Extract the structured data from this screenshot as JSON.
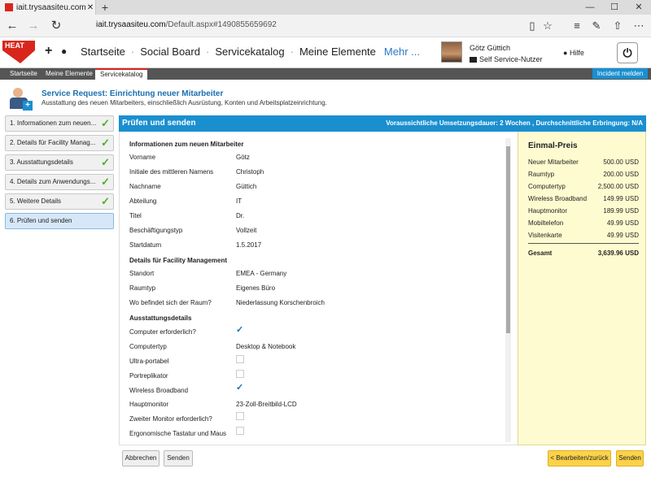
{
  "browser": {
    "tab_title": "iait.trysaasiteu.com:Serv",
    "tab_close": "✕",
    "new_tab": "+",
    "url_host": "iait.trysaasiteu.com",
    "url_path": "/Default.aspx#1490855659692",
    "win_minimize": "—",
    "win_maximize": "☐",
    "win_close": "✕"
  },
  "header": {
    "logo_text": "HEAT",
    "nav_items": [
      "Startseite",
      "Social Board",
      "Servicekatalog",
      "Meine Elemente"
    ],
    "more_label": "Mehr ...",
    "user_name": "Götz Güttich",
    "user_role": "Self Service-Nutzer",
    "help_label": "Hilfe"
  },
  "subnav": {
    "tabs": [
      "Startseite",
      "Meine Elemente",
      "Servicekatalog"
    ],
    "incident_button": "Incident melden"
  },
  "service_request": {
    "title": "Service Request: Einrichtung neuer Mitarbeiter",
    "description": "Ausstattung des neuen Mitarbeiters, einschließlich Ausrüstung, Konten und Arbeitsplatzeinrichtung."
  },
  "steps": [
    {
      "label": "1. Informationen zum neuen...",
      "done": true
    },
    {
      "label": "2. Details für Facility Manag...",
      "done": true
    },
    {
      "label": "3. Ausstattungsdetails",
      "done": true
    },
    {
      "label": "4. Details zum Anwendungs...",
      "done": true
    },
    {
      "label": "5. Weitere Details",
      "done": true
    },
    {
      "label": "6. Prüfen und senden",
      "done": false
    }
  ],
  "panel": {
    "title": "Prüfen und senden",
    "info": "Voraussichtliche Umsetzungsdauer: 2 Wochen , Durchschnittliche Erbringung: N/A"
  },
  "form": {
    "section1_title": "Informationen zum neuen Mitarbeiter",
    "section1": [
      {
        "label": "Vorname",
        "value": "Götz"
      },
      {
        "label": "Initiale des mittleren Namens",
        "value": "Christoph"
      },
      {
        "label": "Nachname",
        "value": "Güttich"
      },
      {
        "label": "Abteilung",
        "value": "IT"
      },
      {
        "label": "Titel",
        "value": "Dr."
      },
      {
        "label": "Beschäftigungstyp",
        "value": "Vollzeit"
      },
      {
        "label": "Startdatum",
        "value": "1.5.2017"
      }
    ],
    "section2_title": "Details für Facility Management",
    "section2": [
      {
        "label": "Standort",
        "value": "EMEA - Germany"
      },
      {
        "label": "Raumtyp",
        "value": "Eigenes Büro"
      },
      {
        "label": "Wo befindet sich der Raum?",
        "value": "Niederlassung Korschenbroich"
      }
    ],
    "section3_title": "Ausstattungsdetails",
    "section3": [
      {
        "label": "Computer erforderlich?",
        "type": "check",
        "checked": true
      },
      {
        "label": "Computertyp",
        "type": "text",
        "value": "Desktop & Notebook"
      },
      {
        "label": "Ultra-portabel",
        "type": "check",
        "checked": false
      },
      {
        "label": "Portreplikator",
        "type": "check",
        "checked": false
      },
      {
        "label": "Wireless Broadband",
        "type": "check",
        "checked": true
      },
      {
        "label": "Hauptmonitor",
        "type": "text",
        "value": "23-Zoll-Breitbild-LCD"
      },
      {
        "label": "Zweiter Monitor erforderlich?",
        "type": "check",
        "checked": false
      },
      {
        "label": "Ergonomische Tastatur und Maus",
        "type": "check",
        "checked": false
      }
    ]
  },
  "price": {
    "title": "Einmal-Preis",
    "rows": [
      {
        "label": "Neuer Mitarbeiter",
        "value": "500.00 USD"
      },
      {
        "label": "Raumtyp",
        "value": "200.00 USD"
      },
      {
        "label": "Computertyp",
        "value": "2,500.00 USD"
      },
      {
        "label": "Wireless Broadband",
        "value": "149.99 USD"
      },
      {
        "label": "Hauptmonitor",
        "value": "189.99 USD"
      },
      {
        "label": "Mobiltelefon",
        "value": "49.99 USD"
      },
      {
        "label": "Visitenkarte",
        "value": "49.99 USD"
      }
    ],
    "total_label": "Gesamt",
    "total_value": "3,639.96 USD"
  },
  "footer": {
    "cancel": "Abbrechen",
    "send_left": "Senden",
    "edit_back": "< Bearbeiten/zurück",
    "send_right": "Senden"
  }
}
